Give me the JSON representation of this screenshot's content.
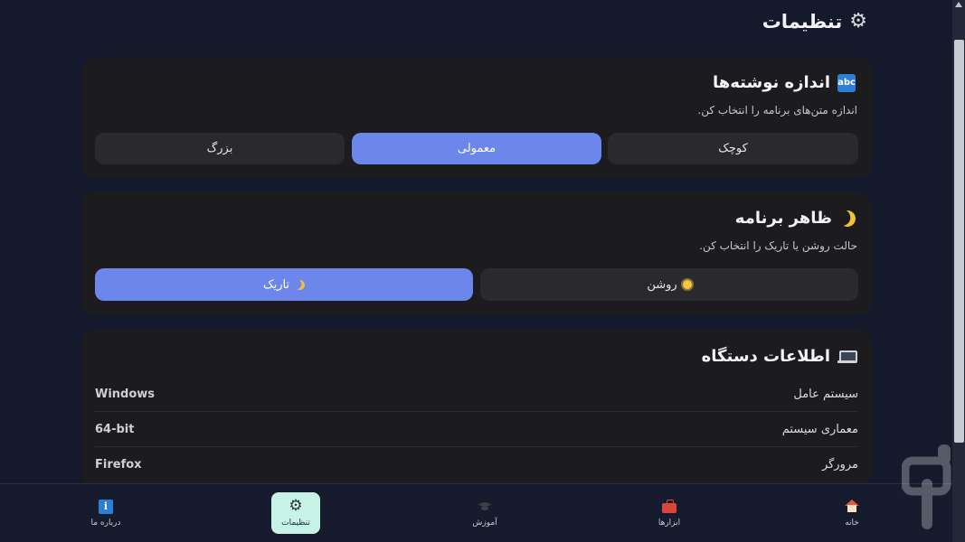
{
  "header": {
    "title": "تنظیمات",
    "icon": "gear-icon"
  },
  "font_size": {
    "title": "اندازه نوشته‌ها",
    "icon_text": "abc",
    "subtitle": "اندازه متن‌های برنامه را انتخاب کن.",
    "options": [
      {
        "label": "کوچک",
        "selected": false
      },
      {
        "label": "معمولی",
        "selected": true
      },
      {
        "label": "بزرگ",
        "selected": false
      }
    ]
  },
  "theme": {
    "title": "ظاهر برنامه",
    "subtitle": "حالت روشن یا تاریک را انتخاب کن.",
    "options": [
      {
        "label": "روشن",
        "icon": "sun-icon",
        "selected": false
      },
      {
        "label": "تاریک",
        "icon": "moon-icon",
        "selected": true
      }
    ]
  },
  "device_info": {
    "title": "اطلاعات دستگاه",
    "rows": [
      {
        "key": "سیستم عامل",
        "value": "Windows"
      },
      {
        "key": "معماری سیستم",
        "value": "64-bit"
      },
      {
        "key": "مرورگر",
        "value": "Firefox"
      }
    ]
  },
  "nav": {
    "items": [
      {
        "label": "خانه",
        "icon": "home-icon",
        "active": false
      },
      {
        "label": "ابزارها",
        "icon": "toolbox-icon",
        "active": false
      },
      {
        "label": "آموزش",
        "icon": "graduation-cap-icon",
        "active": false
      },
      {
        "label": "تنظیمات",
        "icon": "gear-icon",
        "active": true
      },
      {
        "label": "درباره ما",
        "icon": "info-icon",
        "active": false
      }
    ]
  },
  "colors": {
    "background": "#141a2c",
    "card": "#1c1c1f",
    "accent": "#6c86ec",
    "active_nav": "#c7f3e6"
  }
}
